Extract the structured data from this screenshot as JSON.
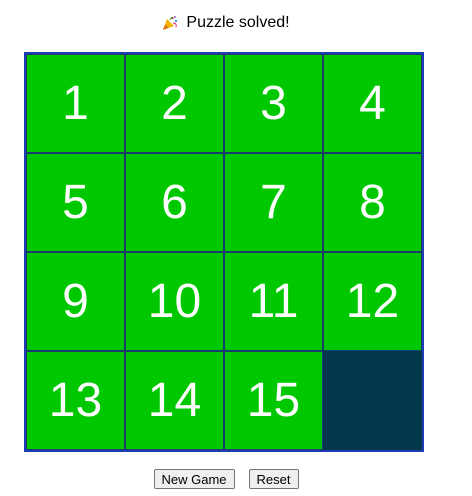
{
  "status": {
    "icon": "party-popper-icon",
    "text": "Puzzle solved!"
  },
  "board": {
    "rows": 4,
    "cols": 4,
    "tiles": [
      "1",
      "2",
      "3",
      "4",
      "5",
      "6",
      "7",
      "8",
      "9",
      "10",
      "11",
      "12",
      "13",
      "14",
      "15",
      ""
    ],
    "colors": {
      "tile": "#00c800",
      "empty": "#03374c",
      "border": "#1f3bb3",
      "text": "#ffffff"
    }
  },
  "controls": {
    "new_game_label": "New Game",
    "reset_label": "Reset"
  }
}
